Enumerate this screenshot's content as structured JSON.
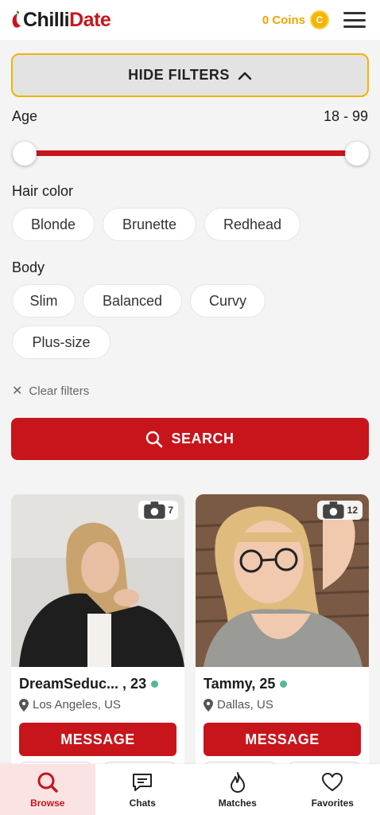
{
  "header": {
    "logo_part1": "Chilli",
    "logo_part2": "Date",
    "coins_label": "0 Coins",
    "coin_symbol": "C"
  },
  "filters": {
    "toggle_label": "HIDE FILTERS",
    "age": {
      "label": "Age",
      "range_text": "18 - 99",
      "min": 18,
      "max": 99
    },
    "hair_color": {
      "label": "Hair color",
      "options": [
        "Blonde",
        "Brunette",
        "Redhead"
      ]
    },
    "body": {
      "label": "Body",
      "options": [
        "Slim",
        "Balanced",
        "Curvy",
        "Plus-size"
      ]
    },
    "clear_label": "Clear filters",
    "search_label": "SEARCH"
  },
  "profiles": [
    {
      "name": "DreamSeduc... , 23",
      "location": "Los Angeles, US",
      "photo_count": "7",
      "online": true,
      "message_label": "MESSAGE"
    },
    {
      "name": "Tammy, 25",
      "location": "Dallas, US",
      "photo_count": "12",
      "online": true,
      "message_label": "MESSAGE"
    }
  ],
  "nav": {
    "items": [
      {
        "label": "Browse",
        "icon": "search-icon",
        "active": true
      },
      {
        "label": "Chats",
        "icon": "chat-icon",
        "active": false
      },
      {
        "label": "Matches",
        "icon": "flame-icon",
        "active": false
      },
      {
        "label": "Favorites",
        "icon": "heart-icon",
        "active": false
      }
    ]
  },
  "colors": {
    "brand_red": "#c8151b",
    "coin_gold": "#f0a500",
    "filter_border": "#f0b400",
    "online_green": "#56b88e"
  }
}
